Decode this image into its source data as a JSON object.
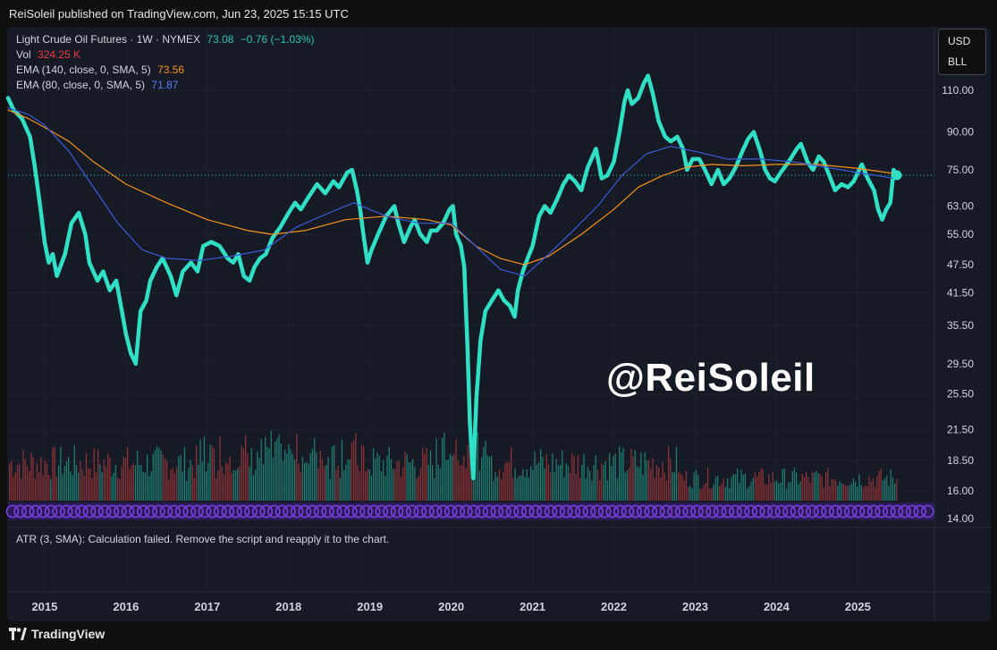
{
  "header": {
    "published": "ReiSoleil published on TradingView.com, Jun 23, 2025 15:15 UTC"
  },
  "legend": {
    "symbol": "Light Crude Oil Futures · 1W · NYMEX",
    "price": "73.08",
    "change": "−0.76 (−1.03%)",
    "vol_label": "Vol",
    "vol_value": "324.25 K",
    "ema1_label": "EMA (140, close, 0, SMA, 5)",
    "ema1_value": "73.56",
    "ema2_label": "EMA (80, close, 0, SMA, 5)",
    "ema2_value": "71.87"
  },
  "currency": {
    "primary": "USD",
    "unit": "BLL"
  },
  "atr_message": "ATR (3, SMA): Calculation failed. Remove the script and reapply it to the chart.",
  "watermark": "@ReiSoleil",
  "footer": {
    "brand": "TradingView"
  },
  "colors": {
    "price_line": "#2fe0c6",
    "ema140": "#f7931a",
    "ema80": "#3b5bdb",
    "vol_up": "#1f9e8a",
    "vol_down": "#b23b3b",
    "change_text": "#26c6b0",
    "vol_text": "#f23645",
    "atr_band": "#7b3fe4",
    "background": "#161a25"
  },
  "chart_data": {
    "type": "line",
    "scale": "log",
    "ylim": [
      14,
      130
    ],
    "y_ticks": [
      "110.00",
      "90.00",
      "75.00",
      "63.00",
      "55.00",
      "47.50",
      "41.50",
      "35.50",
      "29.50",
      "25.50",
      "21.50",
      "18.50",
      "16.00",
      "14.00"
    ],
    "x_ticks": [
      "2015",
      "2016",
      "2017",
      "2018",
      "2019",
      "2020",
      "2021",
      "2022",
      "2023",
      "2024",
      "2025"
    ],
    "last_value": 73.08,
    "series": [
      {
        "name": "Light Crude Oil Futures",
        "role": "price",
        "points": [
          [
            2014.55,
            106
          ],
          [
            2014.62,
            100
          ],
          [
            2014.72,
            96
          ],
          [
            2014.82,
            88
          ],
          [
            2014.88,
            76
          ],
          [
            2014.95,
            62
          ],
          [
            2015.0,
            53
          ],
          [
            2015.05,
            48
          ],
          [
            2015.1,
            50
          ],
          [
            2015.15,
            45
          ],
          [
            2015.25,
            50
          ],
          [
            2015.33,
            58
          ],
          [
            2015.42,
            61
          ],
          [
            2015.5,
            55
          ],
          [
            2015.55,
            48
          ],
          [
            2015.65,
            44
          ],
          [
            2015.72,
            46
          ],
          [
            2015.8,
            42
          ],
          [
            2015.88,
            44
          ],
          [
            2015.95,
            38
          ],
          [
            2016.0,
            34
          ],
          [
            2016.06,
            31
          ],
          [
            2016.12,
            29.5
          ],
          [
            2016.18,
            38
          ],
          [
            2016.25,
            40
          ],
          [
            2016.3,
            44
          ],
          [
            2016.38,
            47
          ],
          [
            2016.45,
            49
          ],
          [
            2016.55,
            45
          ],
          [
            2016.62,
            41
          ],
          [
            2016.7,
            46
          ],
          [
            2016.8,
            48
          ],
          [
            2016.88,
            46
          ],
          [
            2016.95,
            52
          ],
          [
            2017.05,
            53
          ],
          [
            2017.15,
            52
          ],
          [
            2017.25,
            49
          ],
          [
            2017.32,
            48
          ],
          [
            2017.38,
            50
          ],
          [
            2017.45,
            45
          ],
          [
            2017.52,
            44
          ],
          [
            2017.58,
            47
          ],
          [
            2017.65,
            49
          ],
          [
            2017.72,
            50
          ],
          [
            2017.8,
            54
          ],
          [
            2017.9,
            57
          ],
          [
            2018.0,
            61
          ],
          [
            2018.08,
            64
          ],
          [
            2018.15,
            62
          ],
          [
            2018.25,
            66
          ],
          [
            2018.35,
            70
          ],
          [
            2018.45,
            67
          ],
          [
            2018.55,
            71
          ],
          [
            2018.62,
            69
          ],
          [
            2018.72,
            74
          ],
          [
            2018.78,
            75
          ],
          [
            2018.84,
            68
          ],
          [
            2018.88,
            62
          ],
          [
            2018.92,
            55
          ],
          [
            2018.97,
            48
          ],
          [
            2019.02,
            51
          ],
          [
            2019.1,
            55
          ],
          [
            2019.2,
            60
          ],
          [
            2019.3,
            63
          ],
          [
            2019.35,
            58
          ],
          [
            2019.42,
            53
          ],
          [
            2019.5,
            57
          ],
          [
            2019.55,
            59
          ],
          [
            2019.62,
            55
          ],
          [
            2019.7,
            53
          ],
          [
            2019.75,
            56
          ],
          [
            2019.82,
            56
          ],
          [
            2019.9,
            58
          ],
          [
            2019.98,
            62
          ],
          [
            2020.02,
            63
          ],
          [
            2020.06,
            55
          ],
          [
            2020.12,
            52
          ],
          [
            2020.16,
            47
          ],
          [
            2020.2,
            32
          ],
          [
            2020.23,
            22
          ],
          [
            2020.27,
            17
          ],
          [
            2020.31,
            25
          ],
          [
            2020.36,
            33
          ],
          [
            2020.42,
            38
          ],
          [
            2020.5,
            40
          ],
          [
            2020.58,
            42
          ],
          [
            2020.65,
            40
          ],
          [
            2020.72,
            39
          ],
          [
            2020.78,
            37
          ],
          [
            2020.82,
            42
          ],
          [
            2020.88,
            46
          ],
          [
            2020.94,
            49
          ],
          [
            2021.0,
            52
          ],
          [
            2021.08,
            60
          ],
          [
            2021.15,
            63
          ],
          [
            2021.22,
            61
          ],
          [
            2021.3,
            65
          ],
          [
            2021.38,
            70
          ],
          [
            2021.45,
            73
          ],
          [
            2021.52,
            71
          ],
          [
            2021.6,
            68
          ],
          [
            2021.68,
            76
          ],
          [
            2021.78,
            83
          ],
          [
            2021.85,
            72
          ],
          [
            2021.92,
            73
          ],
          [
            2022.0,
            78
          ],
          [
            2022.07,
            90
          ],
          [
            2022.13,
            104
          ],
          [
            2022.17,
            110
          ],
          [
            2022.22,
            103
          ],
          [
            2022.3,
            106
          ],
          [
            2022.37,
            114
          ],
          [
            2022.42,
            118
          ],
          [
            2022.48,
            108
          ],
          [
            2022.55,
            95
          ],
          [
            2022.63,
            88
          ],
          [
            2022.7,
            86
          ],
          [
            2022.78,
            88
          ],
          [
            2022.85,
            83
          ],
          [
            2022.9,
            75
          ],
          [
            2022.97,
            79
          ],
          [
            2023.05,
            79
          ],
          [
            2023.12,
            75
          ],
          [
            2023.2,
            70
          ],
          [
            2023.28,
            75
          ],
          [
            2023.35,
            70
          ],
          [
            2023.42,
            72
          ],
          [
            2023.5,
            76
          ],
          [
            2023.58,
            82
          ],
          [
            2023.65,
            87
          ],
          [
            2023.72,
            90
          ],
          [
            2023.8,
            82
          ],
          [
            2023.86,
            75
          ],
          [
            2023.92,
            72
          ],
          [
            2023.98,
            71
          ],
          [
            2024.05,
            74
          ],
          [
            2024.15,
            78
          ],
          [
            2024.25,
            83
          ],
          [
            2024.3,
            85
          ],
          [
            2024.38,
            78
          ],
          [
            2024.45,
            75
          ],
          [
            2024.52,
            80
          ],
          [
            2024.58,
            78
          ],
          [
            2024.65,
            73
          ],
          [
            2024.72,
            68
          ],
          [
            2024.8,
            70
          ],
          [
            2024.88,
            69
          ],
          [
            2024.95,
            71
          ],
          [
            2025.0,
            74
          ],
          [
            2025.05,
            77
          ],
          [
            2025.12,
            72
          ],
          [
            2025.2,
            68
          ],
          [
            2025.25,
            62
          ],
          [
            2025.3,
            59
          ],
          [
            2025.35,
            62
          ],
          [
            2025.4,
            64
          ],
          [
            2025.44,
            75
          ],
          [
            2025.48,
            73.08
          ]
        ]
      },
      {
        "name": "EMA (140, close, 0, SMA, 5)",
        "role": "ema140",
        "points": [
          [
            2014.55,
            100
          ],
          [
            2014.8,
            96
          ],
          [
            2015.0,
            92
          ],
          [
            2015.3,
            86
          ],
          [
            2015.6,
            78
          ],
          [
            2016.0,
            70
          ],
          [
            2016.5,
            64
          ],
          [
            2017.0,
            59
          ],
          [
            2017.5,
            56
          ],
          [
            2017.8,
            55
          ],
          [
            2018.2,
            56
          ],
          [
            2018.7,
            59
          ],
          [
            2019.2,
            60
          ],
          [
            2019.7,
            59
          ],
          [
            2020.0,
            57.5
          ],
          [
            2020.3,
            52
          ],
          [
            2020.6,
            49
          ],
          [
            2020.9,
            47.5
          ],
          [
            2021.2,
            49.5
          ],
          [
            2021.6,
            55
          ],
          [
            2022.0,
            62
          ],
          [
            2022.3,
            69
          ],
          [
            2022.6,
            73
          ],
          [
            2022.9,
            76
          ],
          [
            2023.2,
            77
          ],
          [
            2023.6,
            76.5
          ],
          [
            2024.0,
            77
          ],
          [
            2024.5,
            77
          ],
          [
            2025.0,
            75.5
          ],
          [
            2025.48,
            73.56
          ]
        ]
      },
      {
        "name": "EMA (80, close, 0, SMA, 5)",
        "role": "ema80",
        "points": [
          [
            2014.55,
            101
          ],
          [
            2014.8,
            98
          ],
          [
            2015.0,
            93
          ],
          [
            2015.3,
            82
          ],
          [
            2015.6,
            69
          ],
          [
            2015.9,
            58
          ],
          [
            2016.2,
            51
          ],
          [
            2016.5,
            49
          ],
          [
            2016.9,
            48.5
          ],
          [
            2017.3,
            49.5
          ],
          [
            2017.7,
            51
          ],
          [
            2018.1,
            57
          ],
          [
            2018.5,
            61
          ],
          [
            2018.8,
            64
          ],
          [
            2019.2,
            60
          ],
          [
            2019.6,
            58
          ],
          [
            2020.0,
            58
          ],
          [
            2020.3,
            52
          ],
          [
            2020.6,
            46.5
          ],
          [
            2020.9,
            45
          ],
          [
            2021.2,
            50
          ],
          [
            2021.5,
            56
          ],
          [
            2021.8,
            63
          ],
          [
            2022.1,
            73
          ],
          [
            2022.4,
            81
          ],
          [
            2022.7,
            84
          ],
          [
            2023.0,
            82
          ],
          [
            2023.4,
            79
          ],
          [
            2023.8,
            79
          ],
          [
            2024.2,
            78
          ],
          [
            2024.6,
            76
          ],
          [
            2025.0,
            74
          ],
          [
            2025.48,
            71.87
          ]
        ]
      }
    ]
  }
}
